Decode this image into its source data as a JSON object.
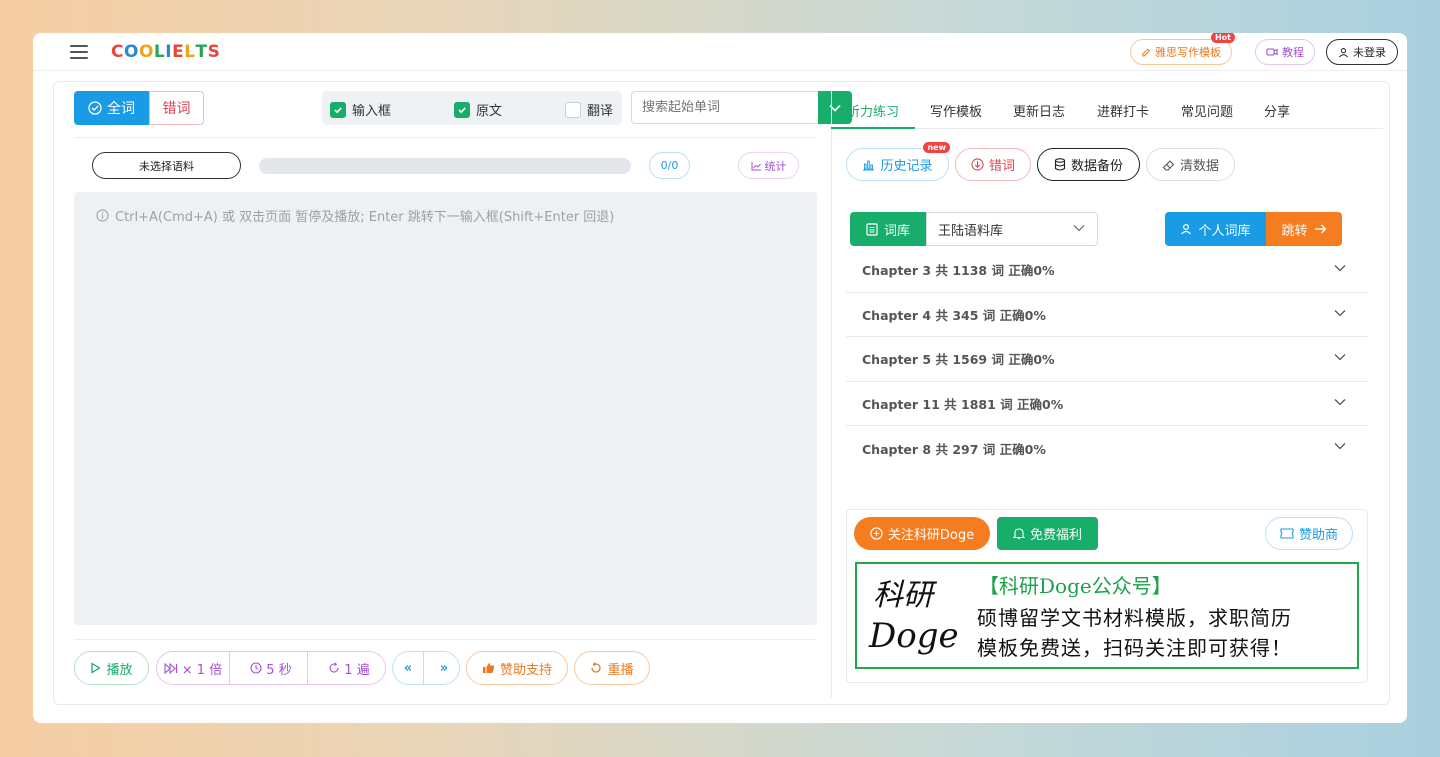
{
  "header": {
    "logo_letters": [
      {
        "ch": "C",
        "color": "#e8453c"
      },
      {
        "ch": "O",
        "color": "#2b88d8"
      },
      {
        "ch": "O",
        "color": "#f3a21b"
      },
      {
        "ch": "L",
        "color": "#26a65b"
      },
      {
        "ch": "I",
        "color": "#2b88d8"
      },
      {
        "ch": "E",
        "color": "#e8453c"
      },
      {
        "ch": "L",
        "color": "#f3a21b"
      },
      {
        "ch": "T",
        "color": "#26a65b"
      },
      {
        "ch": "S",
        "color": "#e8453c"
      }
    ],
    "writing_template": "雅思写作模板",
    "hot_badge": "Hot",
    "tutorial": "教程",
    "login": "未登录"
  },
  "left": {
    "seg_all": "全词",
    "seg_wrong": "错词",
    "checkboxes": [
      {
        "label": "输入框",
        "checked": true
      },
      {
        "label": "原文",
        "checked": true
      },
      {
        "label": "翻译",
        "checked": false
      }
    ],
    "search_placeholder": "搜索起始单词",
    "corpus_button": "未选择语料",
    "progress": 0,
    "count": "0/0",
    "stats": "统计",
    "hint": "Ctrl+A(Cmd+A) 或 双击页面 暂停及播放; Enter 跳转下一输入框(Shift+Enter 回退)",
    "controls": {
      "play": "播放",
      "speed": "× 1 倍",
      "interval": "5 秒",
      "repeat": "1 遍",
      "prev": "«",
      "next": "»",
      "support": "赞助支持",
      "replay": "重播"
    }
  },
  "right": {
    "tabs": [
      "听力练习",
      "写作模板",
      "更新日志",
      "进群打卡",
      "常见问题",
      "分享"
    ],
    "active_tab": 0,
    "history": "历史记录",
    "new_badge": "new",
    "wrong": "错词",
    "backup": "数据备份",
    "clear": "清数据",
    "lib_label": "词库",
    "lib_value": "王陆语料库",
    "my_lib": "个人词库",
    "jump": "跳转",
    "chapters": [
      "Chapter 3 共 1138 词 正确0%",
      "Chapter 4 共 345 词 正确0%",
      "Chapter 5 共 1569 词 正确0%",
      "Chapter 11 共 1881 词 正确0%",
      "Chapter 8 共 297 词 正确0%"
    ],
    "ad": {
      "follow": "关注科研Doge",
      "free": "免费福利",
      "sponsor": "赞助商",
      "logo_top": "科研",
      "logo_bottom": "Doge",
      "title": "【科研Doge公众号】",
      "line1": "硕博留学文书材料模版，求职简历",
      "line2": "模板免费送，扫码关注即可获得！"
    }
  }
}
